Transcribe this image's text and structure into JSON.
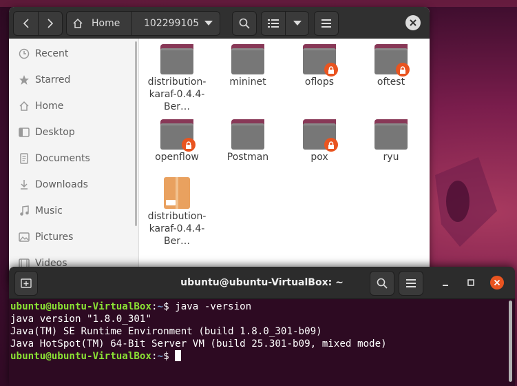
{
  "files": {
    "nav": {
      "back_icon": "chevron-left-icon",
      "forward_icon": "chevron-right-icon"
    },
    "path": {
      "home": "Home",
      "current": "102299105"
    },
    "sidebar": [
      {
        "label": "Recent",
        "icon": "clock-icon"
      },
      {
        "label": "Starred",
        "icon": "star-icon"
      },
      {
        "label": "Home",
        "icon": "home-icon"
      },
      {
        "label": "Desktop",
        "icon": "desktop-icon"
      },
      {
        "label": "Documents",
        "icon": "document-icon"
      },
      {
        "label": "Downloads",
        "icon": "download-icon"
      },
      {
        "label": "Music",
        "icon": "music-icon"
      },
      {
        "label": "Pictures",
        "icon": "picture-icon"
      },
      {
        "label": "Videos",
        "icon": "video-icon"
      }
    ],
    "items": [
      {
        "name": "distribution-karaf-0.4.4-Ber…",
        "type": "folder",
        "locked": false
      },
      {
        "name": "mininet",
        "type": "folder",
        "locked": false
      },
      {
        "name": "oflops",
        "type": "folder",
        "locked": true
      },
      {
        "name": "oftest",
        "type": "folder",
        "locked": true
      },
      {
        "name": "openflow",
        "type": "folder",
        "locked": true
      },
      {
        "name": "Postman",
        "type": "folder",
        "locked": false
      },
      {
        "name": "pox",
        "type": "folder",
        "locked": true
      },
      {
        "name": "ryu",
        "type": "folder",
        "locked": false
      },
      {
        "name": "distribution-karaf-0.4.4-Ber…",
        "type": "archive",
        "locked": false
      }
    ],
    "colors": {
      "folder_tab": "#883857",
      "lock_badge": "#e95420"
    }
  },
  "terminal": {
    "title": "ubuntu@ubuntu-VirtualBox: ~",
    "prompt_user": "ubuntu@ubuntu-VirtualBox",
    "prompt_sep": ":",
    "prompt_path": "~",
    "prompt_end": "$ ",
    "command": "java -version",
    "output": [
      "java version \"1.8.0_301\"",
      "Java(TM) SE Runtime Environment (build 1.8.0_301-b09)",
      "Java HotSpot(TM) 64-Bit Server VM (build 25.301-b09, mixed mode)"
    ],
    "colors": {
      "background": "#2d0a22",
      "user": "#8ae234",
      "path": "#729fcf"
    }
  }
}
